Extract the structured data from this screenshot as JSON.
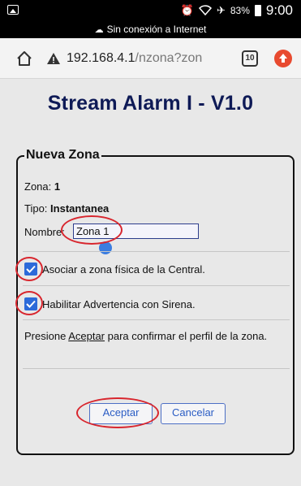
{
  "status_bar": {
    "time": "9:00",
    "battery": "83%",
    "offline_text": "Sin conexión a Internet"
  },
  "browser": {
    "url_host": "192.168.4.1",
    "url_path": "/nzona?zon",
    "tab_count": "10"
  },
  "page": {
    "title": "Stream Alarm I - V1.0",
    "legend": "Nueva Zona",
    "zona_label": "Zona:",
    "zona_value": "1",
    "tipo_label": "Tipo:",
    "tipo_value": "Instantanea",
    "nombre_label": "Nombre:",
    "nombre_value": "Zona 1",
    "check1_label": "Asociar a zona física de la Central.",
    "check1_checked": true,
    "check2_label": "Habilitar Advertencia con Sirena.",
    "check2_checked": true,
    "instruction_pre": "Presione ",
    "instruction_link": "Aceptar",
    "instruction_post": " para confirmar el perfil de la zona.",
    "accept_label": "Aceptar",
    "cancel_label": "Cancelar"
  },
  "colors": {
    "title": "#0e1a56",
    "checkbox": "#2c6ad9",
    "annotation": "#d8262e",
    "button_text": "#2a5cc4"
  }
}
